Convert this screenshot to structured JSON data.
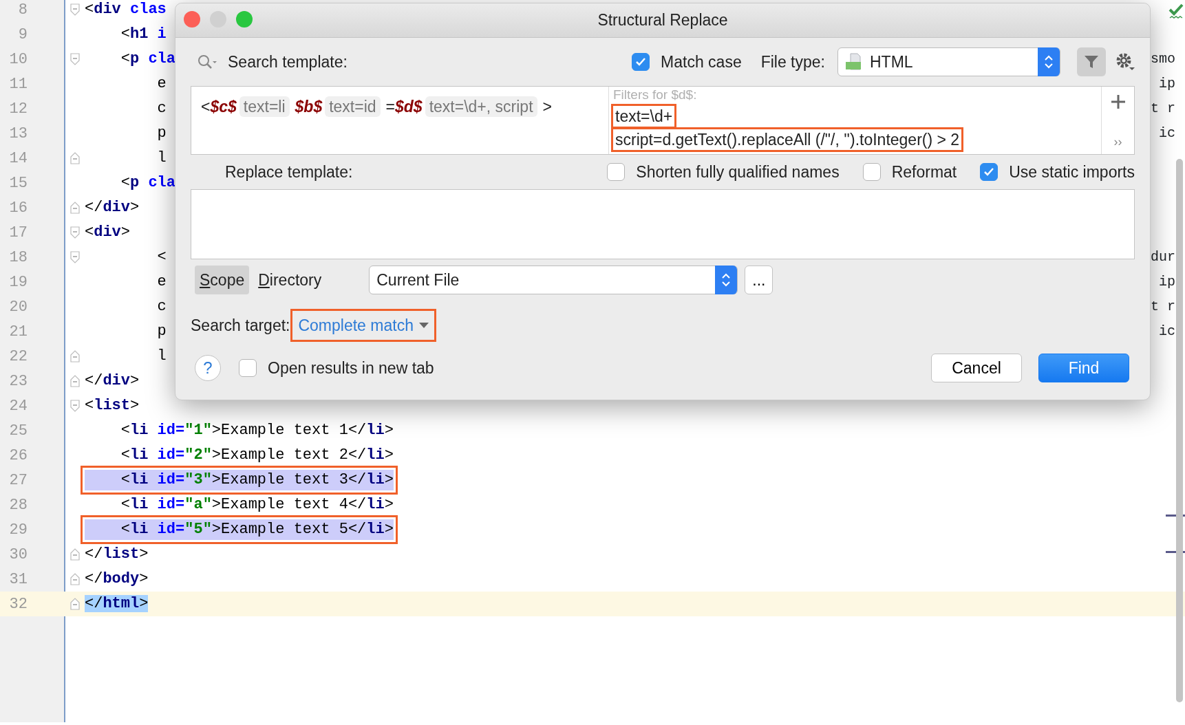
{
  "editor": {
    "lines": [
      {
        "number": "8",
        "fold_start": true,
        "tokens": [
          {
            "kind": "punct",
            "text": "<"
          },
          {
            "kind": "tag",
            "text": "div"
          },
          {
            "kind": "attr",
            "text": " clas"
          }
        ]
      },
      {
        "number": "9",
        "tokens": [
          {
            "kind": "punct",
            "text": "    <"
          },
          {
            "kind": "tag",
            "text": "h1"
          },
          {
            "kind": "attr",
            "text": " i"
          }
        ]
      },
      {
        "number": "10",
        "fold_start": true,
        "tokens": [
          {
            "kind": "punct",
            "text": "    <"
          },
          {
            "kind": "tag",
            "text": "p"
          },
          {
            "kind": "attr",
            "text": " cla"
          }
        ],
        "right": "smo"
      },
      {
        "number": "11",
        "tokens": [
          {
            "kind": "punct",
            "text": "        e"
          }
        ],
        "right": "ip"
      },
      {
        "number": "12",
        "tokens": [
          {
            "kind": "punct",
            "text": "        c"
          }
        ],
        "right": "t r"
      },
      {
        "number": "13",
        "tokens": [
          {
            "kind": "punct",
            "text": "        p"
          }
        ],
        "right": "ic"
      },
      {
        "number": "14",
        "fold_end": true,
        "tokens": [
          {
            "kind": "punct",
            "text": "        l"
          }
        ]
      },
      {
        "number": "15",
        "tokens": [
          {
            "kind": "punct",
            "text": "    <"
          },
          {
            "kind": "tag",
            "text": "p"
          },
          {
            "kind": "attr",
            "text": " cla"
          }
        ]
      },
      {
        "number": "16",
        "fold_end": true,
        "tokens": [
          {
            "kind": "punct",
            "text": "</"
          },
          {
            "kind": "tag",
            "text": "div"
          },
          {
            "kind": "punct",
            "text": ">"
          }
        ]
      },
      {
        "number": "17",
        "fold_start": true,
        "tokens": [
          {
            "kind": "punct",
            "text": "<"
          },
          {
            "kind": "tag",
            "text": "div"
          },
          {
            "kind": "punct",
            "text": ">"
          }
        ]
      },
      {
        "number": "18",
        "fold_start": true,
        "tokens": [
          {
            "kind": "punct",
            "text": "        <"
          }
        ],
        "right": "dur"
      },
      {
        "number": "19",
        "tokens": [
          {
            "kind": "punct",
            "text": "        e"
          }
        ],
        "right": "ip"
      },
      {
        "number": "20",
        "tokens": [
          {
            "kind": "punct",
            "text": "        c"
          }
        ],
        "right": "t r"
      },
      {
        "number": "21",
        "tokens": [
          {
            "kind": "punct",
            "text": "        p"
          }
        ],
        "right": "ic"
      },
      {
        "number": "22",
        "fold_end": true,
        "tokens": [
          {
            "kind": "punct",
            "text": "        l"
          }
        ]
      },
      {
        "number": "23",
        "fold_end": true,
        "tokens": [
          {
            "kind": "punct",
            "text": "</"
          },
          {
            "kind": "tag",
            "text": "div"
          },
          {
            "kind": "punct",
            "text": ">"
          }
        ]
      },
      {
        "number": "24",
        "fold_start": true,
        "tokens": [
          {
            "kind": "punct",
            "text": "<"
          },
          {
            "kind": "tag",
            "text": "list"
          },
          {
            "kind": "punct",
            "text": ">"
          }
        ]
      },
      {
        "number": "25",
        "tokens": [
          {
            "kind": "punct",
            "text": "    <"
          },
          {
            "kind": "tag",
            "text": "li"
          },
          {
            "kind": "attr",
            "text": " id="
          },
          {
            "kind": "value",
            "text": "\"1\""
          },
          {
            "kind": "punct",
            "text": ">Example text 1</"
          },
          {
            "kind": "tag",
            "text": "li"
          },
          {
            "kind": "punct",
            "text": ">"
          }
        ]
      },
      {
        "number": "26",
        "tokens": [
          {
            "kind": "punct",
            "text": "    <"
          },
          {
            "kind": "tag",
            "text": "li"
          },
          {
            "kind": "attr",
            "text": " id="
          },
          {
            "kind": "value",
            "text": "\"2\""
          },
          {
            "kind": "punct",
            "text": ">Example text 2</"
          },
          {
            "kind": "tag",
            "text": "li"
          },
          {
            "kind": "punct",
            "text": ">"
          }
        ]
      },
      {
        "number": "27",
        "highlighted": true,
        "annotated": true,
        "tokens": [
          {
            "kind": "punct",
            "text": "    <"
          },
          {
            "kind": "tag",
            "text": "li"
          },
          {
            "kind": "attr",
            "text": " id="
          },
          {
            "kind": "value",
            "text": "\"3\""
          },
          {
            "kind": "punct",
            "text": ">Example text 3</"
          },
          {
            "kind": "tag",
            "text": "li"
          },
          {
            "kind": "punct",
            "text": ">"
          }
        ]
      },
      {
        "number": "28",
        "tokens": [
          {
            "kind": "punct",
            "text": "    <"
          },
          {
            "kind": "tag",
            "text": "li"
          },
          {
            "kind": "attr",
            "text": " id="
          },
          {
            "kind": "value",
            "text": "\"a\""
          },
          {
            "kind": "punct",
            "text": ">Example text 4</"
          },
          {
            "kind": "tag",
            "text": "li"
          },
          {
            "kind": "punct",
            "text": ">"
          }
        ]
      },
      {
        "number": "29",
        "highlighted": true,
        "annotated": true,
        "tokens": [
          {
            "kind": "punct",
            "text": "    <"
          },
          {
            "kind": "tag",
            "text": "li"
          },
          {
            "kind": "attr",
            "text": " id="
          },
          {
            "kind": "value",
            "text": "\"5\""
          },
          {
            "kind": "punct",
            "text": ">Example text 5</"
          },
          {
            "kind": "tag",
            "text": "li"
          },
          {
            "kind": "punct",
            "text": ">"
          }
        ]
      },
      {
        "number": "30",
        "fold_end": true,
        "tokens": [
          {
            "kind": "punct",
            "text": "</"
          },
          {
            "kind": "tag",
            "text": "list"
          },
          {
            "kind": "punct",
            "text": ">"
          }
        ]
      },
      {
        "number": "31",
        "fold_end": true,
        "tokens": [
          {
            "kind": "punct",
            "text": "</"
          },
          {
            "kind": "tag",
            "text": "body"
          },
          {
            "kind": "punct",
            "text": ">"
          }
        ]
      },
      {
        "number": "32",
        "fold_end": true,
        "current": true,
        "tokens": [
          {
            "kind": "punct",
            "text": "</"
          },
          {
            "kind": "tag",
            "text": "html"
          },
          {
            "kind": "punct",
            "text": ">"
          }
        ]
      }
    ]
  },
  "dialog": {
    "title": "Structural Replace",
    "search_label": "Search template:",
    "match_case": {
      "label": "Match case",
      "checked": true
    },
    "file_type": {
      "label": "File type:",
      "value": "HTML"
    },
    "filter_button": {
      "pressed": true
    },
    "template": [
      {
        "kind": "text",
        "text": "<"
      },
      {
        "kind": "var",
        "text": "$c$"
      },
      {
        "kind": "chip",
        "text": "text=li"
      },
      {
        "kind": "var",
        "text": "$b$"
      },
      {
        "kind": "chip",
        "text": "text=id"
      },
      {
        "kind": "text",
        "text": "="
      },
      {
        "kind": "var",
        "text": "$d$"
      },
      {
        "kind": "chip",
        "text": "text=\\d+, script"
      },
      {
        "kind": "text",
        "text": ">"
      }
    ],
    "filters": {
      "heading": "Filters for $d$:",
      "items": [
        {
          "text": "text=\\d+",
          "annotated": true
        },
        {
          "text": "script=d.getText().replaceAll (/\"/, '').toInteger() > 2",
          "annotated": true
        }
      ]
    },
    "more_button": "››",
    "replace_label": "Replace template:",
    "options": [
      {
        "label": "Shorten fully qualified names",
        "checked": false
      },
      {
        "label": "Reformat",
        "checked": false
      },
      {
        "label": "Use static imports",
        "checked": true
      }
    ],
    "scope_tabs": [
      {
        "label": "Scope",
        "selected": true
      },
      {
        "label": "Directory",
        "selected": false
      }
    ],
    "scope_value": "Current File",
    "browse_button": "...",
    "search_target": {
      "label": "Search target:",
      "value": "Complete match",
      "annotated": true
    },
    "help": "?",
    "open_in_new_tab": {
      "label": "Open results in new tab",
      "checked": false
    },
    "buttons": [
      {
        "label": "Cancel",
        "kind": "secondary"
      },
      {
        "label": "Find",
        "kind": "primary"
      }
    ]
  }
}
